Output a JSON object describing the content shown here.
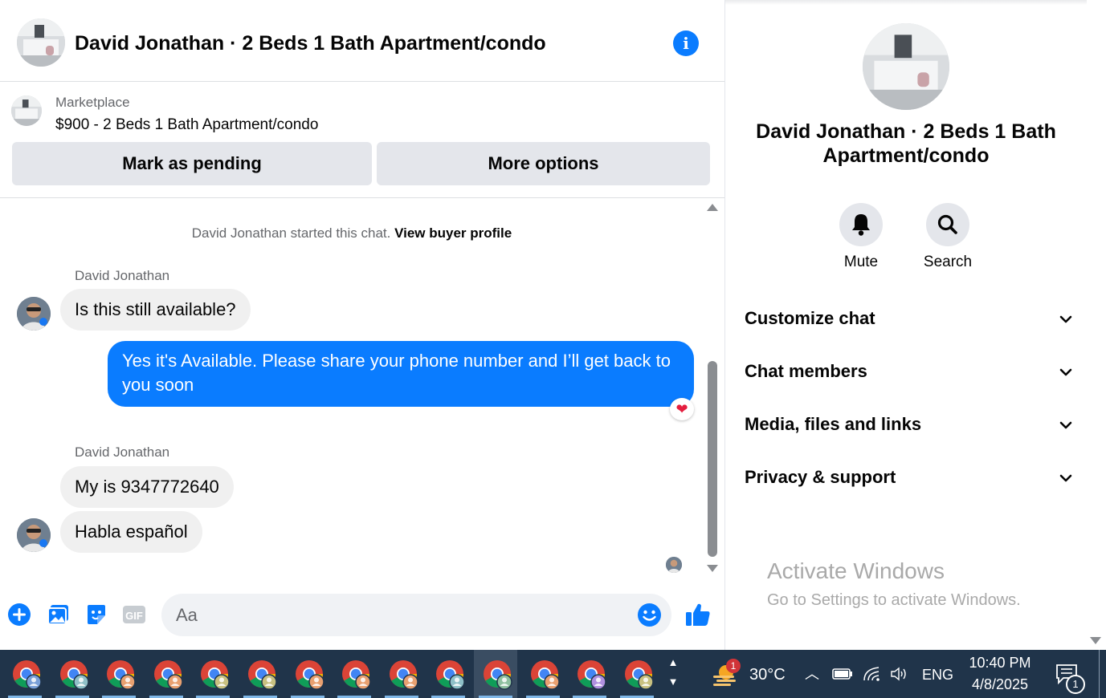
{
  "header": {
    "title": "David Jonathan · 2 Beds 1 Bath Apartment/condo"
  },
  "listing": {
    "source": "Marketplace",
    "price_title": "$900 - 2 Beds 1 Bath Apartment/condo",
    "mark_pending_label": "Mark as pending",
    "more_options_label": "More options"
  },
  "messages": {
    "system_prefix": "David Jonathan started this chat.",
    "system_link": "View buyer profile",
    "groups": [
      {
        "sender": "David Jonathan",
        "texts": [
          "Is this still available?"
        ]
      },
      {
        "sender": "me",
        "texts": [
          "Yes it's Available. Please share your phone number and I’ll get back to you soon"
        ],
        "reaction": "heart"
      },
      {
        "sender": "David Jonathan",
        "texts": [
          "My is 9347772640",
          "Habla español"
        ]
      }
    ]
  },
  "composer": {
    "placeholder": "Aa",
    "icons": [
      "plus-icon",
      "photo-icon",
      "sticker-icon",
      "gif-icon",
      "emoji-icon",
      "thumbs-up-icon"
    ],
    "gif_label": "GIF"
  },
  "info_panel": {
    "name": "David Jonathan · 2 Beds 1 Bath Apartment/condo",
    "actions": [
      {
        "label": "Mute",
        "icon": "bell-icon"
      },
      {
        "label": "Search",
        "icon": "search-icon"
      }
    ],
    "sections": [
      "Customize chat",
      "Chat members",
      "Media, files and links",
      "Privacy & support"
    ]
  },
  "watermark": {
    "title": "Activate Windows",
    "subtitle": "Go to Settings to activate Windows."
  },
  "taskbar": {
    "app_count": 14,
    "active_index": 10,
    "profile_colors": [
      "#7aa0d8",
      "#8fc0c8",
      "#e8a070",
      "#e8a070",
      "#c8c080",
      "#c8c080",
      "#e8a070",
      "#e8a070",
      "#e8a070",
      "#8fc0c8",
      "#8fc0a0",
      "#e8a070",
      "#b090e0",
      "#c8c080"
    ],
    "weather_badge": "1",
    "temperature": "30°C",
    "language": "ENG",
    "time": "10:40 PM",
    "date": "4/8/2025",
    "notification_count": "1"
  },
  "colors": {
    "accent": "#0a7cff",
    "bubble_in": "#f0f0f0",
    "taskbar": "#20344a"
  }
}
